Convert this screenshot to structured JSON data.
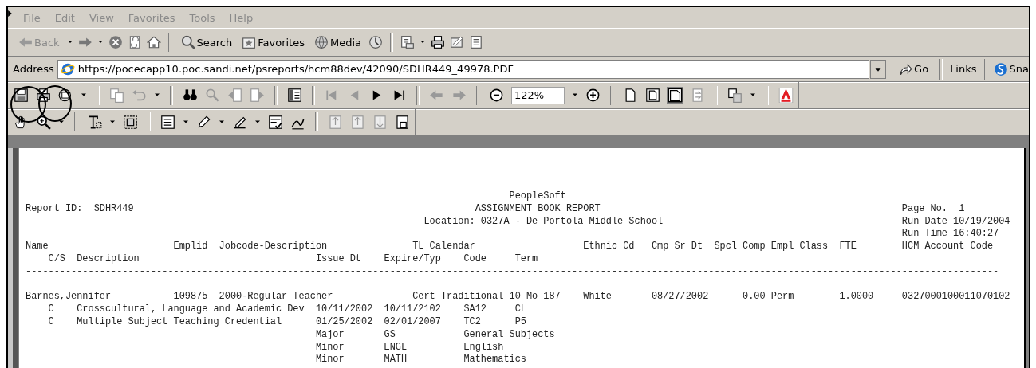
{
  "menu": [
    {
      "label": "File"
    },
    {
      "label": "Edit"
    },
    {
      "label": "View"
    },
    {
      "label": "Favorites"
    },
    {
      "label": "Tools"
    },
    {
      "label": "Help"
    }
  ],
  "browser_toolbar": {
    "buttons": [
      {
        "label": "Back",
        "disabled": true
      },
      {
        "label": "Search",
        "disabled": false
      },
      {
        "label": "Favorites",
        "disabled": false
      },
      {
        "label": "Media",
        "disabled": false
      }
    ]
  },
  "address_bar": {
    "label": "Address",
    "url": "https://pocecapp10.poc.sandi.net/psreports/hcm88dev/42090/SDHR449_49978.PDF",
    "go": "Go",
    "links": "Links",
    "cut_item": "Sna"
  },
  "pdf_toolbar": {
    "zoom": "122%"
  },
  "report": {
    "header_lines": [
      "                                                                                     PeopleSoft",
      "Report ID:  SDHR449                                                            ASSIGNMENT BOOK REPORT                                                     Page No.  1",
      "                                                                      Location: 0327A - De Portola Middle School                                          Run Date 10/19/2004",
      "                                                                                                                                                          Run Time 16:40:27",
      "Name                      Emplid  Jobcode-Description               TL Calendar                   Ethnic Cd   Cmp Sr Dt  Spcl Comp Empl Class  FTE        HCM Account Code",
      "    C/S  Description                               Issue Dt    Expire/Typ    Code     Term",
      "---------------------------------------------------------------------------------------------------------------------------------------------------------------------------"
    ],
    "record_lines": [
      "Barnes,Jennifer           109875  2000-Regular Teacher              Cert Traditional 10 Mo 187    White       08/27/2002      0.00 Perm        1.0000     0327000100011070102",
      "    C    Crosscultural, Language and Academic Dev  10/11/2002  10/11/2102    SA12     CL",
      "    C    Multiple Subject Teaching Credential      01/25/2002  02/01/2007    TC2      P5",
      "                                                   Major       GS            General Subjects",
      "                                                   Minor       ENGL          English",
      "                                                   Minor       MATH          Mathematics"
    ]
  }
}
